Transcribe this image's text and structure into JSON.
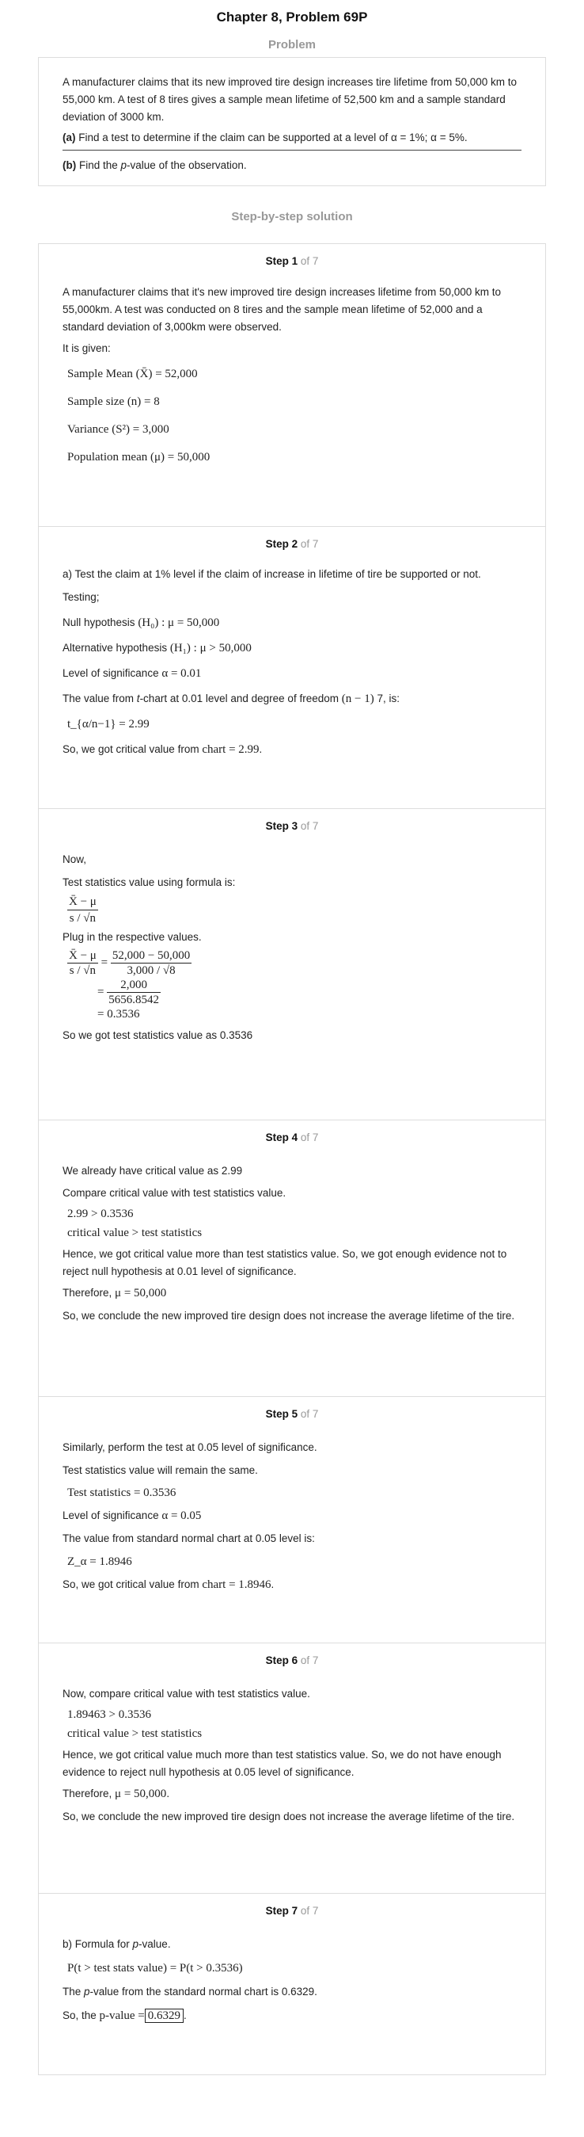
{
  "header": {
    "title": "Chapter 8, Problem 69P"
  },
  "problem": {
    "label": "Problem",
    "text": "A manufacturer claims that its new improved tire design increases tire lifetime from 50,000 km to 55,000 km. A test of 8 tires gives a sample mean lifetime of 52,500 km and a sample standard deviation of 3000 km.",
    "part_a_tag": "(a)",
    "part_a_text": " Find a test to determine if the claim can be supported at a level of α = 1%; α = 5%.",
    "part_b_tag": "(b)",
    "part_b_text_1": " Find the ",
    "part_b_italic": "p",
    "part_b_text_2": "-value of the observation."
  },
  "solution": {
    "label": "Step-by-step solution"
  },
  "steps": [
    {
      "num": "Step 1",
      "of": "of 7",
      "text1": "A manufacturer claims that it's new improved tire design increases lifetime from 50,000 km to 55,000km. A test was conducted on 8 tires and the sample mean lifetime of 52,000 and a standard deviation of 3,000km were observed.",
      "text2": "It is given:",
      "m1": "Sample Mean (X̄) = 52,000",
      "m2": "Sample size (n) = 8",
      "m3": "Variance (S²) = 3,000",
      "m4": "Population mean (μ) = 50,000"
    },
    {
      "num": "Step 2",
      "of": "of 7",
      "text1": "a) Test the claim at 1% level if the claim of increase in lifetime of tire be supported or not.",
      "text2": "Testing;",
      "null_label": "Null hypothesis",
      "null_math": "(H₀) : μ = 50,000",
      "alt_label": "Alternative hypothesis",
      "alt_math": "(H₁) : μ > 50,000",
      "los_label": "Level of significance",
      "los_math": "α = 0.01",
      "tchart_1": "The value from ",
      "tchart_italic": "t",
      "tchart_2": "-chart at 0.01 level and degree of freedom",
      "tchart_math": "(n − 1)",
      "tchart_3": " 7, is:",
      "t_value": "t_{α/n−1} = 2.99",
      "crit_text": "So, we got critical value from",
      "crit_math": "chart = 2.99",
      "crit_end": "."
    },
    {
      "num": "Step 3",
      "of": "of 7",
      "text1": "Now,",
      "text2": "Test statistics value using formula is:",
      "f_num": "X̄ − μ",
      "f_den": "s / √n",
      "text3": "Plug in the respective values.",
      "c_num1": "X̄ − μ",
      "c_den1": "s / √n",
      "c_num2": "52,000 − 50,000",
      "c_den2": "3,000 / √8",
      "c_num3": "2,000",
      "c_den3": "5656.8542",
      "c_res": "= 0.3536",
      "text4": "So we got test statistics value as 0.3536"
    },
    {
      "num": "Step 4",
      "of": "of 7",
      "text1": "We already have critical value as 2.99",
      "text2": "Compare critical value with test statistics value.",
      "m1": "2.99 > 0.3536",
      "m2": "critical value > test statistics",
      "text3": "Hence, we got critical value more than test statistics value. So, we got enough evidence not to reject null hypothesis at 0.01 level of significance.",
      "therefore": "Therefore,",
      "therefore_math": "μ = 50,000",
      "text4": "So, we conclude the new improved tire design does not increase the average lifetime of the tire."
    },
    {
      "num": "Step 5",
      "of": "of 7",
      "text1": "Similarly, perform the test at 0.05 level of significance.",
      "text2": "Test statistics value will remain the same.",
      "m1": "Test statistics = 0.3536",
      "los_label": "Level of significance",
      "los_math": "α = 0.05",
      "text3": "The value from standard normal chart at 0.05 level is:",
      "z_value": "Z_α = 1.8946",
      "crit_text": "So, we got critical value from",
      "crit_math": "chart = 1.8946",
      "crit_end": "."
    },
    {
      "num": "Step 6",
      "of": "of 7",
      "text1": "Now, compare critical value with test statistics value.",
      "m1": "1.89463 > 0.3536",
      "m2": "critical value > test statistics",
      "text2": "Hence, we got critical value much more than test statistics value. So, we do not have enough evidence to reject null hypothesis at 0.05 level of significance.",
      "therefore": "Therefore,",
      "therefore_math": "μ = 50,000",
      "therefore_end": ".",
      "text3": "So, we conclude the new improved tire design does not increase the average lifetime of the tire."
    },
    {
      "num": "Step 7",
      "of": "of 7",
      "text1_a": "b) Formula for ",
      "text1_italic": "p",
      "text1_b": "-value.",
      "m1": "P(t > test stats value) = P(t > 0.3536)",
      "text2_a": "The ",
      "text2_italic": "p",
      "text2_b": "-value from the standard normal chart is 0.6329.",
      "text3": "So, the",
      "pval_label": "p-value =",
      "pval": "0.6329",
      "text3_end": "."
    }
  ]
}
